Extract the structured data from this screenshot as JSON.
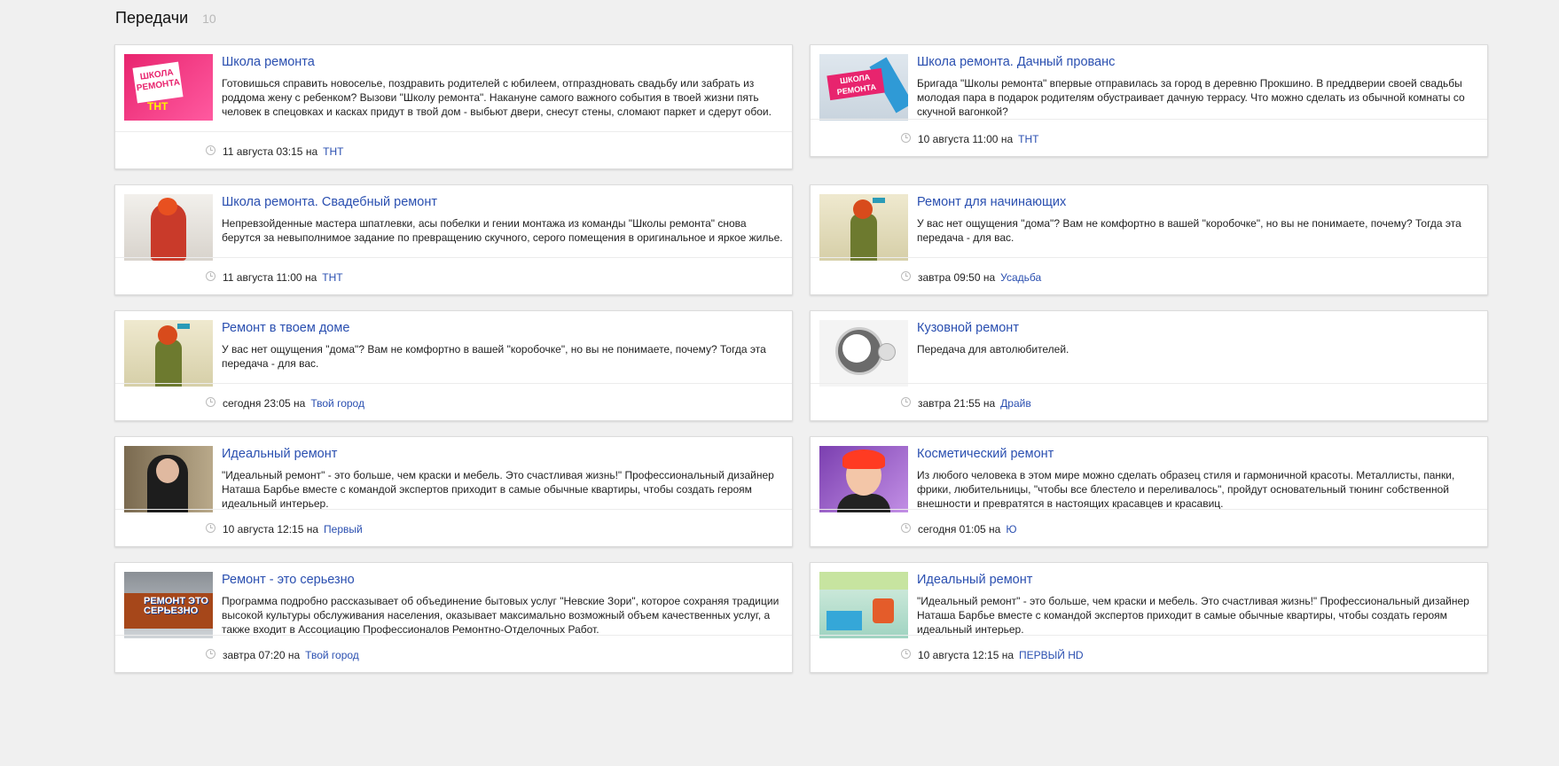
{
  "header": {
    "title": "Передачи",
    "count": "10"
  },
  "programs": [
    {
      "title": "Школа ремонта",
      "description": "Готовишься справить новоселье, поздравить родителей с юбилеем, отпраздновать свадьбу или забрать из роддома жену с ребенком? Вызови \"Школу ремонта\". Накануне самого важного события в твоей жизни пять человек в спецовках и касках придут в твой дом - выбьют двери, снесут стены, сломают паркет и сдерут обои.",
      "time": "11 августа 03:15",
      "on": "на",
      "channel": "ТНТ",
      "thumb_logo": "ШКОЛА РЕМОНТА",
      "thumb_tag": "ТНТ"
    },
    {
      "title": "Школа ремонта. Дачный прованс",
      "description": "Бригада \"Школы ремонта\" впервые отправилась за город в деревню Прокшино. В преддверии своей свадьбы молодая пара в подарок родителям обустраивает дачную террасу. Что можно сделать из обычной комнаты со скучной вагонкой?",
      "time": "10 августа 11:00",
      "on": "на",
      "channel": "ТНТ",
      "thumb_logo": "ШКОЛА РЕМОНТА"
    },
    {
      "title": "Школа ремонта. Свадебный ремонт",
      "description": "Непревзойденные мастера шпатлевки, асы побелки и гении монтажа из команды \"Школы ремонта\" снова берутся за невыполнимое задание по превращению скучного, серого помещения в оригинальное и яркое жилье.",
      "time": "11 августа 11:00",
      "on": "на",
      "channel": "ТНТ"
    },
    {
      "title": "Ремонт для начинающих",
      "description": "У вас нет ощущения \"дома\"? Вам не комфортно в вашей \"коробочке\", но вы не понимаете, почему? Тогда эта передача - для вас.",
      "time": "завтра 09:50",
      "on": "на",
      "channel": "Усадьба"
    },
    {
      "title": "Ремонт в твоем доме",
      "description": "У вас нет ощущения \"дома\"? Вам не комфортно в вашей \"коробочке\", но вы не понимаете, почему? Тогда эта передача - для вас.",
      "time": "сегодня 23:05",
      "on": "на",
      "channel": "Твой город"
    },
    {
      "title": "Кузовной ремонт",
      "description": "Передача для автолюбителей.",
      "time": "завтра 21:55",
      "on": "на",
      "channel": "Драйв"
    },
    {
      "title": "Идеальный ремонт",
      "description": "\"Идеальный ремонт\" - это больше, чем краски и мебель. Это счастливая жизнь!\" Профессиональный дизайнер Наташа Барбье вместе с командой экспертов приходит в самые обычные квартиры, чтобы создать героям идеальный интерьер.",
      "time": "10 августа 12:15",
      "on": "на",
      "channel": "Первый"
    },
    {
      "title": "Косметический ремонт",
      "description": "Из любого человека в этом мире можно сделать образец стиля и гармоничной красоты. Металлисты, панки, фрики, любительницы, \"чтобы все блестело и переливалось\", пройдут основательный тюнинг собственной внешности и превратятся в настоящих красавцев и красавиц.",
      "time": "сегодня 01:05",
      "on": "на",
      "channel": "Ю"
    },
    {
      "title": "Ремонт - это серьезно",
      "description": "Программа подробно рассказывает об объединение бытовых услуг \"Невские Зори\", которое сохраняя традиции высокой культуры обслуживания населения, оказывает максимально возможный объем качественных услуг, а также входит в Ассоциацию Профессионалов Ремонтно-Отделочных Работ.",
      "time": "завтра 07:20",
      "on": "на",
      "channel": "Твой город",
      "thumb_logo": "РЕМОНТ ЭТО СЕРЬЕЗНО"
    },
    {
      "title": "Идеальный ремонт",
      "description": "\"Идеальный ремонт\" - это больше, чем краски и мебель. Это счастливая жизнь!\" Профессиональный дизайнер Наташа Барбье вместе с командой экспертов приходит в самые обычные квартиры, чтобы создать героям идеальный интерьер.",
      "time": "10 августа 12:15",
      "on": "на",
      "channel": "ПЕРВЫЙ HD"
    }
  ]
}
